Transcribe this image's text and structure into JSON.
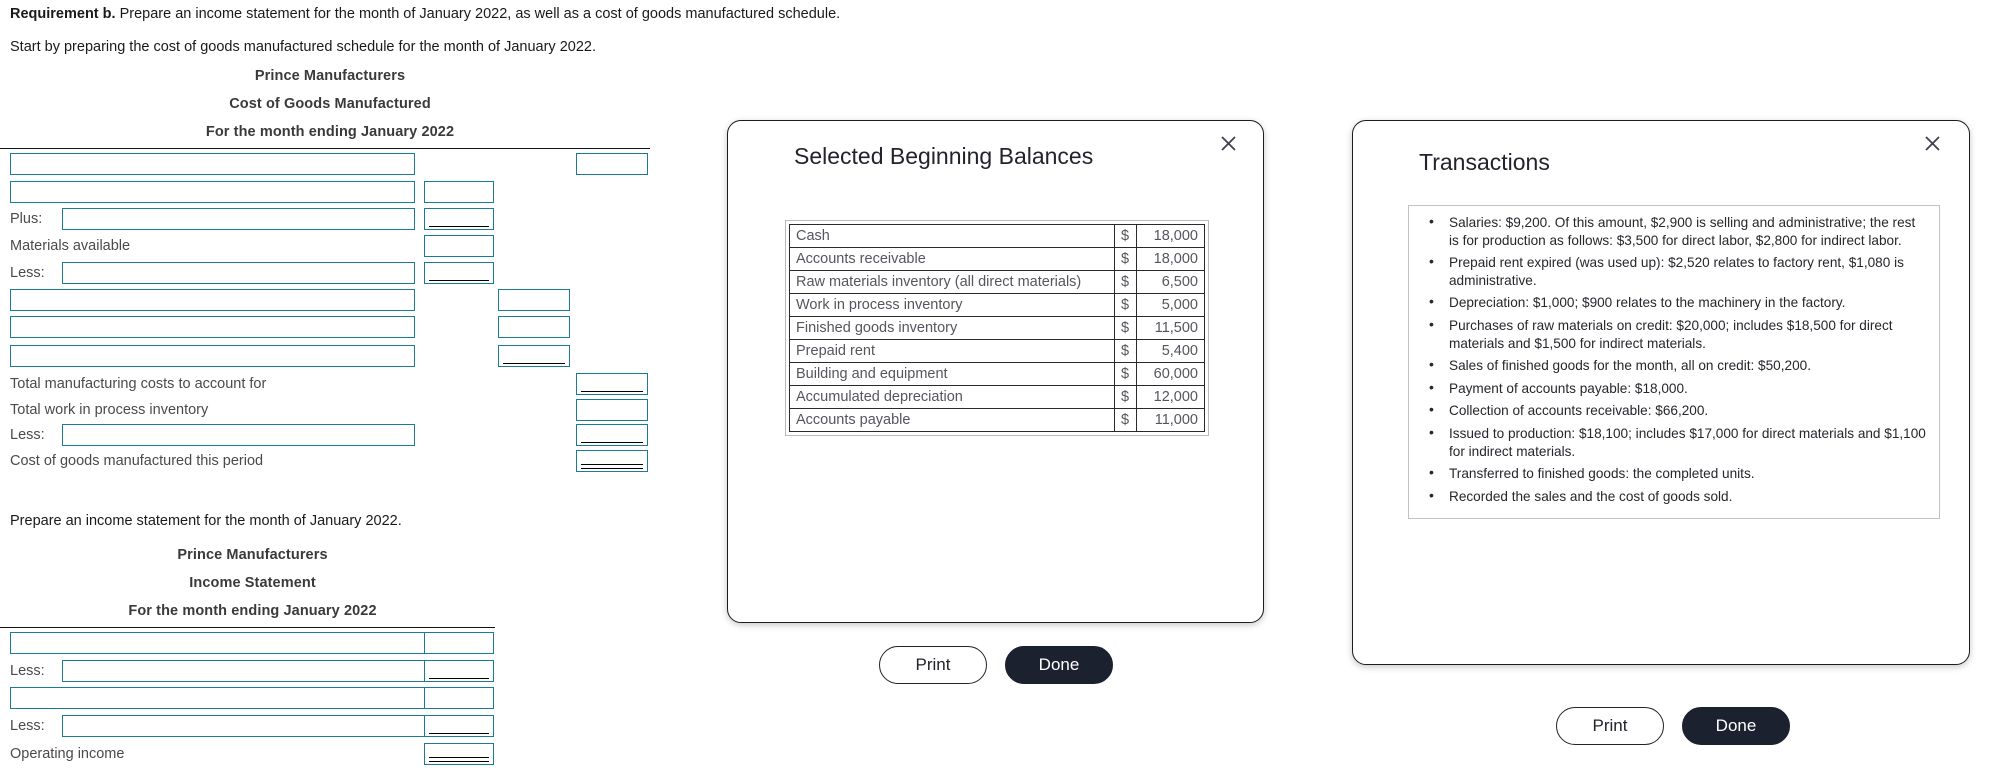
{
  "prompt": {
    "requirement_label": "Requirement b.",
    "requirement_text": " Prepare an income statement for the month of January 2022, as well as a cost of goods manufactured schedule.",
    "start_text": "Start by preparing the cost of goods manufactured schedule for the month of January 2022.",
    "income_text": "Prepare an income statement for the month of January 2022."
  },
  "cogm": {
    "company": "Prince Manufacturers",
    "statement": "Cost of Goods Manufactured",
    "period": "For the month ending January 2022",
    "labels": {
      "plus": "Plus:",
      "materials_available": "Materials available",
      "less": "Less:",
      "total_mfg_costs": "Total manufacturing costs to account for",
      "total_wip": "Total work in process inventory",
      "cogm_this_period": "Cost of goods manufactured this period"
    }
  },
  "income": {
    "company": "Prince Manufacturers",
    "statement": "Income Statement",
    "period": "For the month ending January 2022",
    "labels": {
      "less": "Less:",
      "operating_income": "Operating income"
    }
  },
  "balances_dialog": {
    "title": "Selected Beginning Balances",
    "rows": [
      {
        "account": "Cash",
        "currency": "$",
        "amount": "18,000"
      },
      {
        "account": "Accounts receivable",
        "currency": "$",
        "amount": "18,000"
      },
      {
        "account": "Raw materials inventory (all direct materials)",
        "currency": "$",
        "amount": "6,500"
      },
      {
        "account": "Work in process inventory",
        "currency": "$",
        "amount": "5,000"
      },
      {
        "account": "Finished goods inventory",
        "currency": "$",
        "amount": "11,500"
      },
      {
        "account": "Prepaid rent",
        "currency": "$",
        "amount": "5,400"
      },
      {
        "account": "Building and equipment",
        "currency": "$",
        "amount": "60,000"
      },
      {
        "account": "Accumulated depreciation",
        "currency": "$",
        "amount": "12,000"
      },
      {
        "account": "Accounts payable",
        "currency": "$",
        "amount": "11,000"
      }
    ],
    "print_label": "Print",
    "done_label": "Done"
  },
  "transactions_dialog": {
    "title": "Transactions",
    "items": [
      "Salaries: $9,200. Of this amount, $2,900 is selling and administrative; the rest is for production as follows: $3,500 for direct labor, $2,800 for indirect labor.",
      "Prepaid rent expired (was used up): $2,520 relates to factory rent, $1,080 is administrative.",
      "Depreciation: $1,000; $900 relates to the machinery in the factory.",
      "Purchases of raw materials on credit: $20,000; includes $18,500 for direct materials and $1,500 for indirect materials.",
      "Sales of finished goods for the month, all on credit: $50,200.",
      "Payment of accounts payable: $18,000.",
      "Collection of accounts receivable: $66,200.",
      "Issued to production: $18,100; includes $17,000 for direct materials and $1,100 for indirect materials.",
      "Transferred to finished goods: the completed units.",
      "Recorded the sales and the cost of goods sold."
    ],
    "print_label": "Print",
    "done_label": "Done"
  },
  "icons": {
    "minimize": "minimize-icon",
    "close": "close-icon"
  },
  "colors": {
    "input_border": "#1b7a96",
    "dialog_border": "#1c1c22",
    "done_button": "#1c2130"
  }
}
